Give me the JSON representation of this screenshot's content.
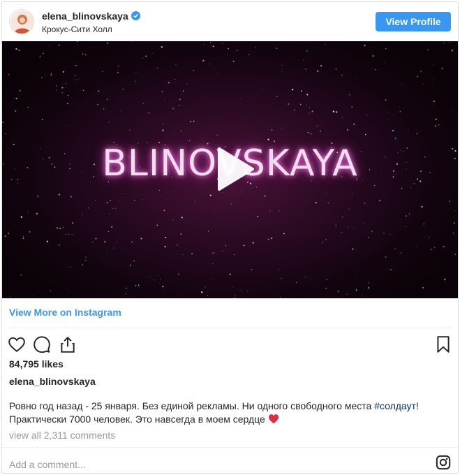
{
  "header": {
    "username": "elena_blinovskaya",
    "location": "Крокус-Сити Холл",
    "view_profile_label": "View Profile",
    "verified_icon": "verified-badge-icon"
  },
  "media": {
    "title": "BLINOVSKAYA",
    "play_icon": "play-icon"
  },
  "links": {
    "view_more": "View More on Instagram"
  },
  "actions": {
    "icons": [
      "heart-icon",
      "comment-icon",
      "share-icon",
      "bookmark-icon"
    ]
  },
  "post": {
    "likes": "84,795 likes",
    "caption_user": "elena_blinovskaya",
    "caption_line1_prefix": "Ровно год назад - 25 января. Без единой рекламы. Ни одного свободного места ",
    "caption_hashtag": "#солдаут",
    "caption_line1_suffix": "!",
    "caption_line2": "Практически 7000 человек. Это навсегда в моем сердце ",
    "comments_link": "view all 2,311 comments",
    "add_comment_placeholder": "Add a comment..."
  },
  "colors": {
    "accent": "#3897f0",
    "hashtag": "#003569",
    "muted": "#999999",
    "heart_emoji": "#e0245e"
  }
}
